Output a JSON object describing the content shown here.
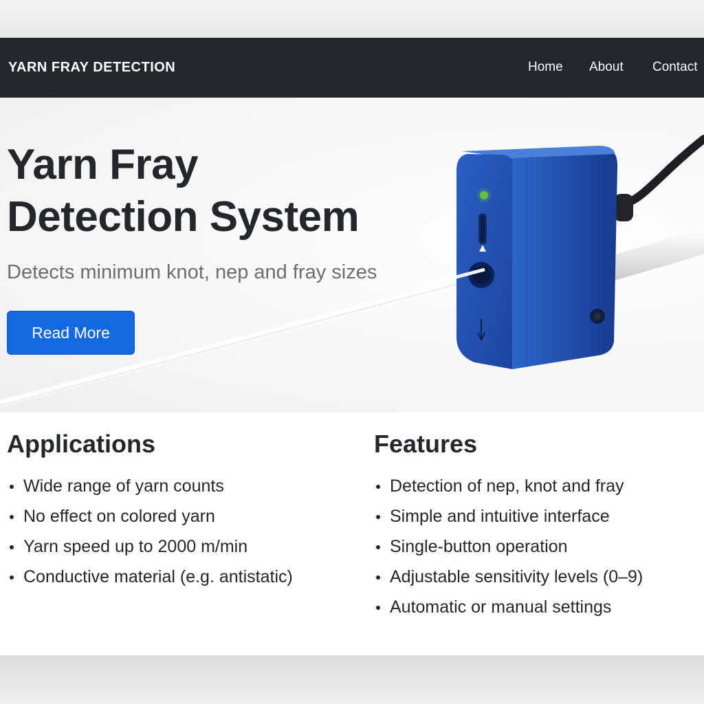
{
  "navbar": {
    "brand": "YARN FRAY DETECTION",
    "links": [
      "Home",
      "About",
      "Contact"
    ]
  },
  "hero": {
    "title_line1": "Yarn Fray",
    "title_line2": "Detection System",
    "subtitle": "Detects minimum knot, nep and fray sizes",
    "button_label": "Read More",
    "image": "blue yarn sensor device with cable and yarn thread"
  },
  "applications": {
    "title": "Applications",
    "items": [
      "Wide range of yarn counts",
      "No effect on colored yarn",
      "Yarn speed up to 2000 m/min",
      "Conductive material (e.g. antistatic)"
    ]
  },
  "features": {
    "title": "Features",
    "items": [
      "Detection of nep, knot and fray",
      "Simple and intuitive interface",
      "Single-button operation",
      "Adjustable sensitivity levels (0–9)",
      "Automatic or manual settings"
    ]
  },
  "colors": {
    "navbar_bg": "#23262b",
    "button_bg": "#1469e0",
    "device_blue": "#2150b0",
    "led_green": "#63c43b"
  }
}
